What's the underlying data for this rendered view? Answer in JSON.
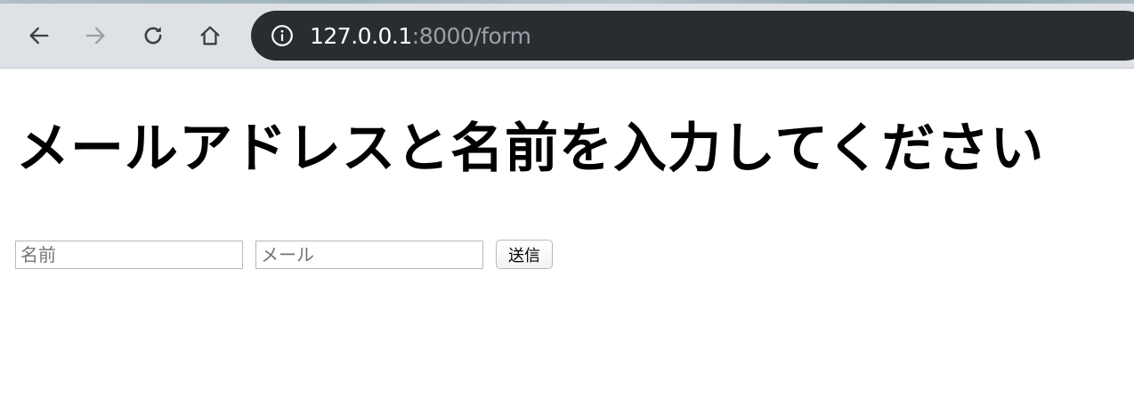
{
  "browser": {
    "url_host": "127.0.0.1",
    "url_rest": ":8000/form",
    "icons": {
      "back": "arrow-left-icon",
      "forward": "arrow-right-icon",
      "reload": "reload-icon",
      "home": "home-icon",
      "info": "info-icon"
    }
  },
  "page": {
    "heading": "メールアドレスと名前を入力してください",
    "form": {
      "name_placeholder": "名前",
      "name_value": "",
      "email_placeholder": "メール",
      "email_value": "",
      "submit_label": "送信"
    }
  },
  "colors": {
    "toolbar_bg": "#dee1e6",
    "omnibox_bg": "#292c30",
    "url_host": "#ffffff",
    "url_rest": "#9aa0a6",
    "forward_disabled": "#9aa0a6"
  }
}
